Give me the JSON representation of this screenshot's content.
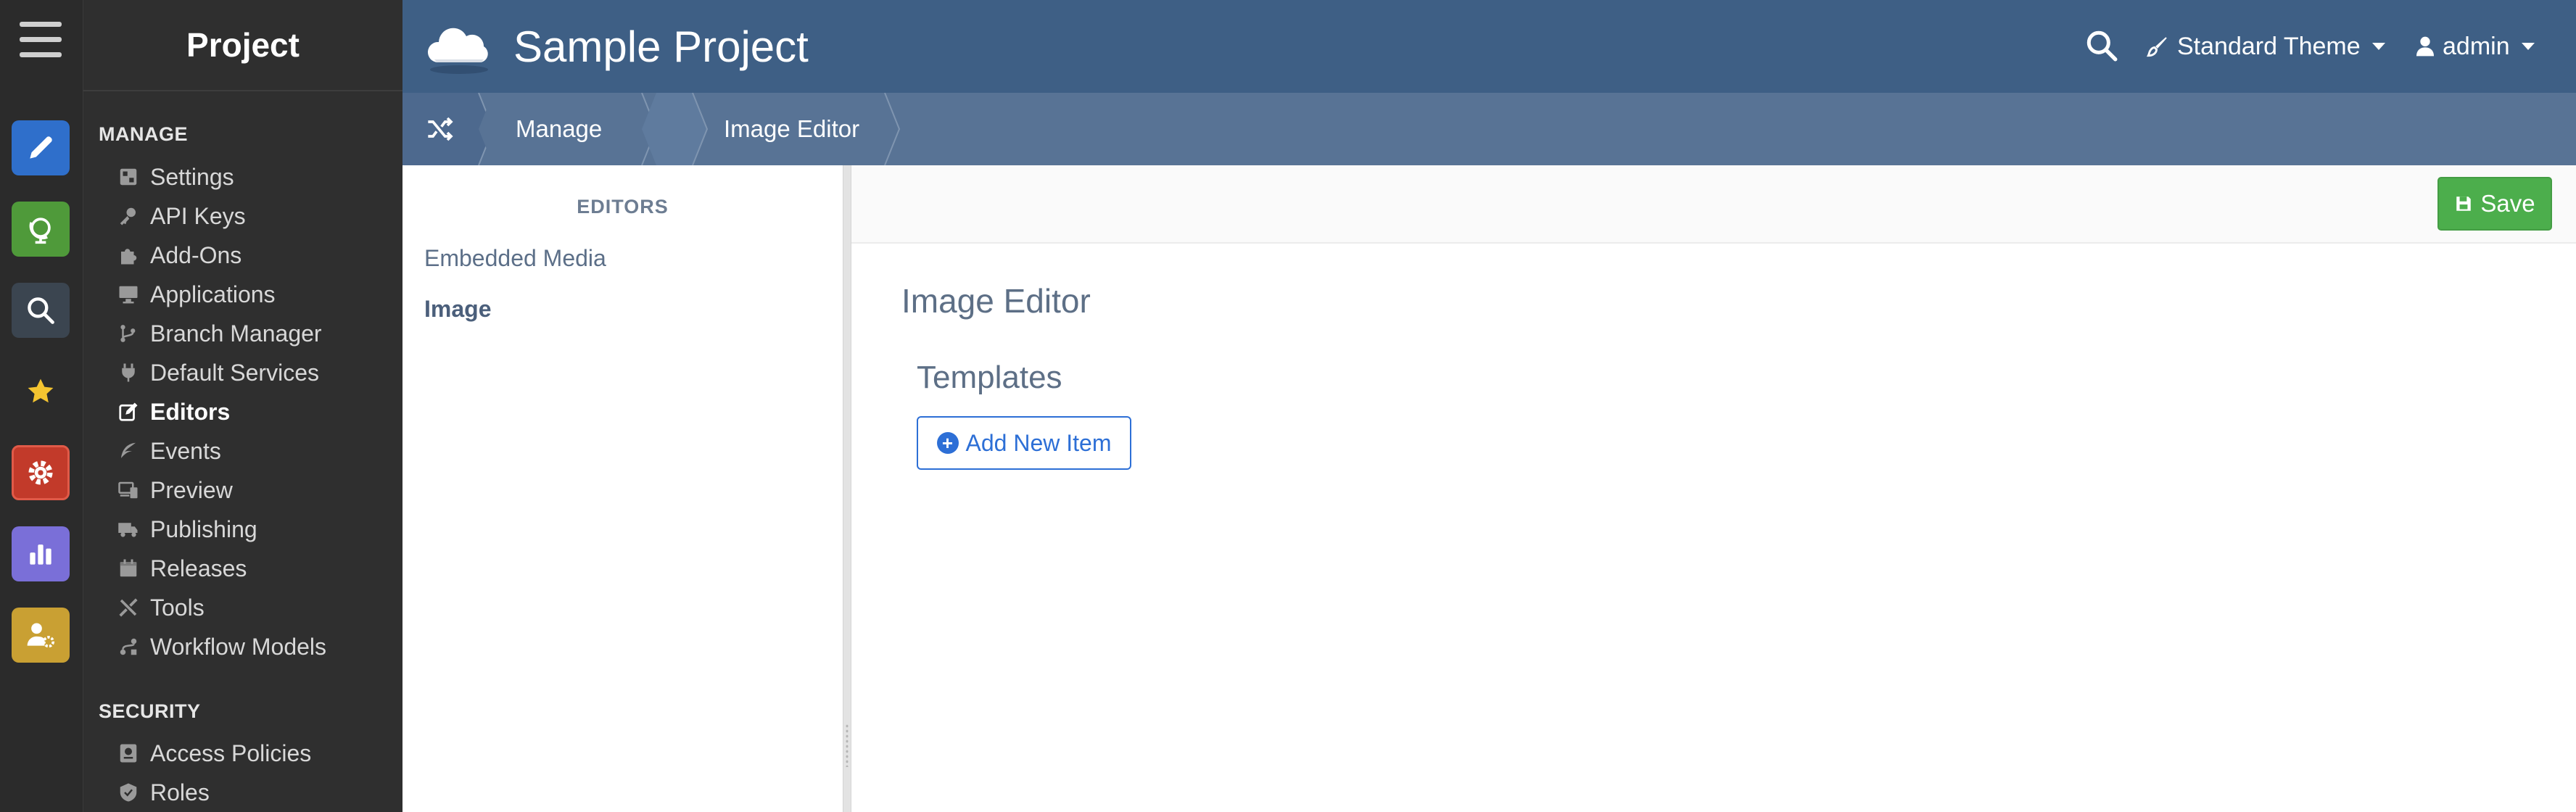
{
  "nav": {
    "title": "Project",
    "sections": {
      "manage": "MANAGE",
      "security": "SECURITY"
    },
    "manage_items": [
      {
        "label": "Settings",
        "icon": "settings-icon"
      },
      {
        "label": "API Keys",
        "icon": "key-icon"
      },
      {
        "label": "Add-Ons",
        "icon": "puzzle-icon"
      },
      {
        "label": "Applications",
        "icon": "monitor-icon"
      },
      {
        "label": "Branch Manager",
        "icon": "branch-icon"
      },
      {
        "label": "Default Services",
        "icon": "plug-icon"
      },
      {
        "label": "Editors",
        "icon": "edit-icon",
        "active": true
      },
      {
        "label": "Events",
        "icon": "feather-icon"
      },
      {
        "label": "Preview",
        "icon": "devices-icon"
      },
      {
        "label": "Publishing",
        "icon": "truck-icon"
      },
      {
        "label": "Releases",
        "icon": "calendar-icon"
      },
      {
        "label": "Tools",
        "icon": "tools-icon"
      },
      {
        "label": "Workflow Models",
        "icon": "workflow-icon"
      }
    ],
    "security_items": [
      {
        "label": "Access Policies",
        "icon": "policy-icon"
      },
      {
        "label": "Roles",
        "icon": "shield-icon"
      }
    ]
  },
  "rail": {
    "buttons": [
      {
        "icon": "pencil-icon",
        "color": "#2f6fcb"
      },
      {
        "icon": "globe-icon",
        "color": "#4f9a3a"
      },
      {
        "icon": "search-icon",
        "color": "#3b4550"
      },
      {
        "icon": "star-icon",
        "color": "transparent"
      },
      {
        "icon": "gear-icon",
        "color": "#c23a2a"
      },
      {
        "icon": "bar-chart-icon",
        "color": "#7a6fd8"
      },
      {
        "icon": "user-gear-icon",
        "color": "#c9a033"
      }
    ]
  },
  "header": {
    "project_name": "Sample Project",
    "theme_label": "Standard Theme",
    "user_label": "admin",
    "color": "#3e5f85"
  },
  "breadcrumb": {
    "items": [
      "Manage",
      "Image Editor"
    ]
  },
  "editors_panel": {
    "heading": "EDITORS",
    "items": [
      {
        "label": "Embedded Media",
        "active": false
      },
      {
        "label": "Image",
        "active": true
      }
    ]
  },
  "main": {
    "save_label": "Save",
    "title": "Image Editor",
    "templates_heading": "Templates",
    "add_item_label": "Add New Item"
  },
  "colors": {
    "accent_blue": "#2d6fd6",
    "save_green": "#4cae4c",
    "sidebar_dark": "#2f2f2f"
  }
}
